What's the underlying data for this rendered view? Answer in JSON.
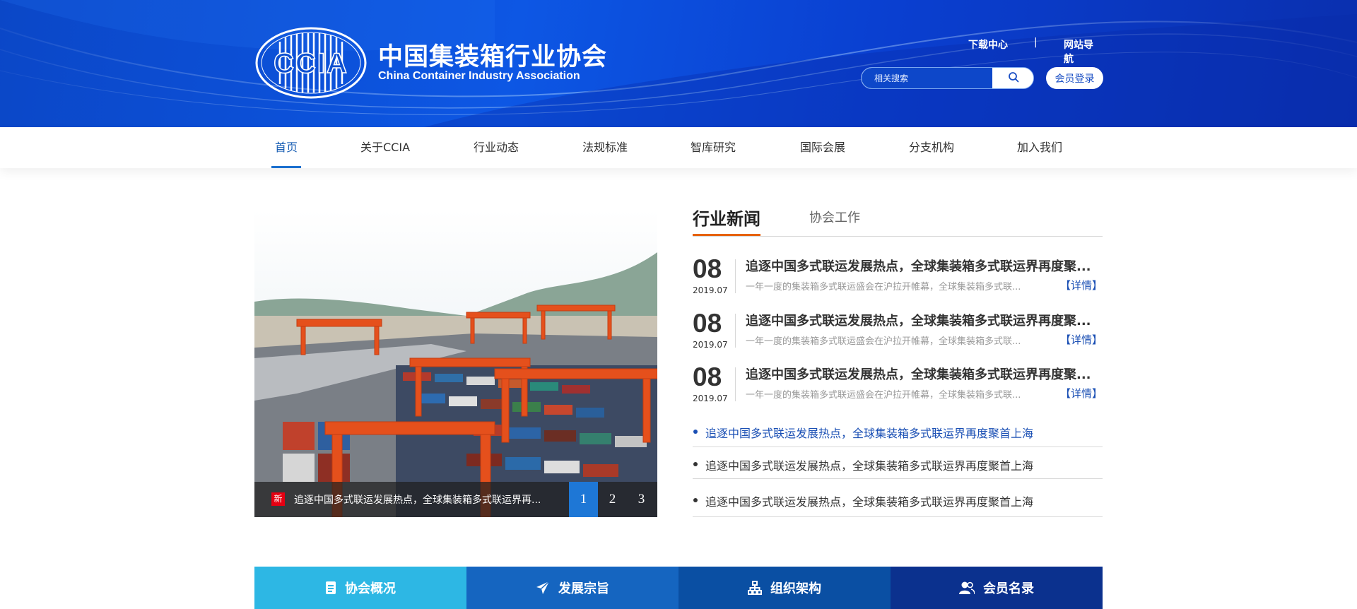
{
  "brand": {
    "logo_text": "CCIA",
    "title": "中国集装箱行业协会",
    "subtitle": "China Container Industry Association"
  },
  "top_links": {
    "download": "下载中心",
    "separator": "|",
    "site_nav": "网站导航"
  },
  "search": {
    "placeholder": "相关搜索",
    "icon": "search-icon"
  },
  "login_label": "会员登录",
  "nav": [
    "首页",
    "关于CCIA",
    "行业动态",
    "法规标准",
    "智库研究",
    "国际会展",
    "分支机构",
    "加入我们"
  ],
  "nav_active": "首页",
  "hero": {
    "badge": "新",
    "caption": "追逐中国多式联运发展热点，全球集装箱多式联运界再...",
    "pages": [
      "1",
      "2",
      "3"
    ],
    "active_page": "1"
  },
  "news": {
    "tabs": [
      "行业新闻",
      "协会工作"
    ],
    "active_tab": "行业新闻",
    "featured": [
      {
        "day": "08",
        "ym": "2019.07",
        "title": "追逐中国多式联运发展热点，全球集装箱多式联运界再度聚...",
        "summary": "一年一度的集装箱多式联运盛会在沪拉开帷幕，全球集装箱多式联...",
        "detail": "【详情】"
      },
      {
        "day": "08",
        "ym": "2019.07",
        "title": "追逐中国多式联运发展热点，全球集装箱多式联运界再度聚...",
        "summary": "一年一度的集装箱多式联运盛会在沪拉开帷幕，全球集装箱多式联...",
        "detail": "【详情】"
      },
      {
        "day": "08",
        "ym": "2019.07",
        "title": "追逐中国多式联运发展热点，全球集装箱多式联运界再度聚...",
        "summary": "一年一度的集装箱多式联运盛会在沪拉开帷幕，全球集装箱多式联...",
        "detail": "【详情】"
      }
    ],
    "list": [
      "追逐中国多式联运发展热点，全球集装箱多式联运界再度聚首上海",
      "追逐中国多式联运发展热点，全球集装箱多式联运界再度聚首上海",
      "追逐中国多式联运发展热点，全球集装箱多式联运界再度聚首上海"
    ]
  },
  "quick_links": [
    {
      "label": "协会概况",
      "icon": "document-icon",
      "color": "#2db7e4"
    },
    {
      "label": "发展宗旨",
      "icon": "paper-plane-icon",
      "color": "#1565c0"
    },
    {
      "label": "组织架构",
      "icon": "org-chart-icon",
      "color": "#0a4fa3"
    },
    {
      "label": "会员名录",
      "icon": "users-icon",
      "color": "#0b318e"
    }
  ]
}
